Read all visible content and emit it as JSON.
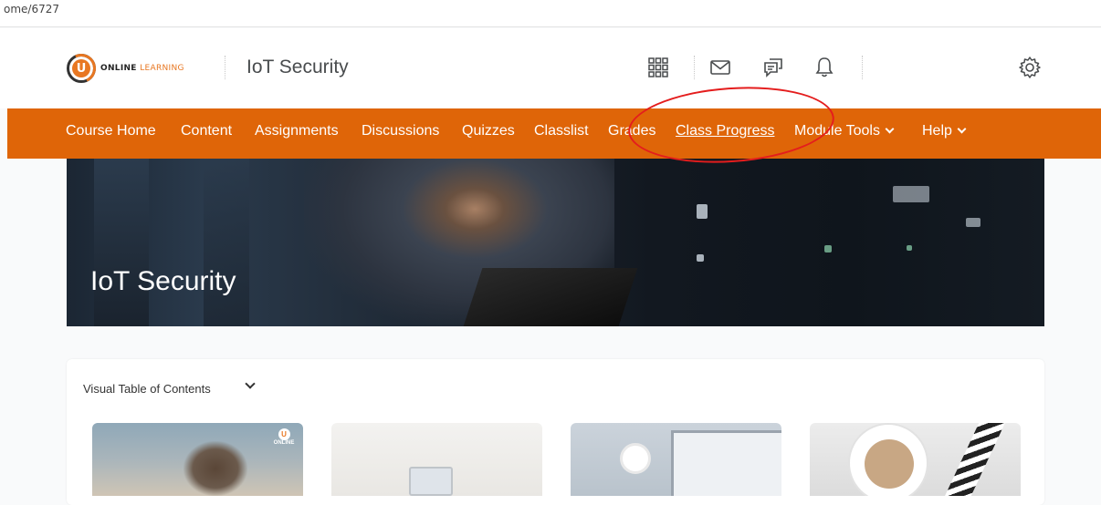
{
  "browser": {
    "url_fragment": "ome/6727"
  },
  "header": {
    "logo": {
      "letter": "U",
      "text_a": "ONLINE",
      "text_b": "LEARNING"
    },
    "course_title": "IoT Security",
    "icons": [
      "apps-grid-icon",
      "mail-icon",
      "chat-icon",
      "bell-icon",
      "gear-icon"
    ]
  },
  "nav": {
    "items": [
      {
        "label": "Course Home"
      },
      {
        "label": "Content"
      },
      {
        "label": "Assignments"
      },
      {
        "label": "Discussions"
      },
      {
        "label": "Quizzes"
      },
      {
        "label": "Classlist"
      },
      {
        "label": "Grades"
      },
      {
        "label": "Class Progress"
      },
      {
        "label": "Module Tools"
      },
      {
        "label": "Help"
      }
    ],
    "bg_color": "#df6508"
  },
  "banner": {
    "title": "IoT Security"
  },
  "vtoc": {
    "label": "Visual Table of Contents",
    "thumb_badge": {
      "letter": "U",
      "text": "ONLINE"
    }
  },
  "annotation": {
    "color": "#e41d1d"
  }
}
